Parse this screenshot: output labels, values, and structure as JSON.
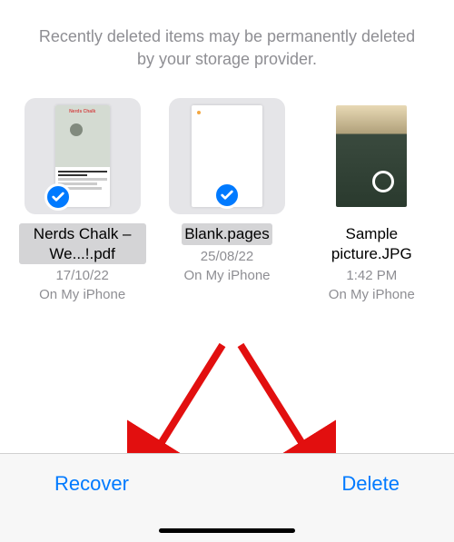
{
  "header": {
    "message": "Recently deleted items may be permanently deleted by your storage provider."
  },
  "items": [
    {
      "name": "Nerds Chalk – We...!.pdf",
      "date": "17/10/22",
      "location": "On My iPhone",
      "selected": true,
      "thumb_type": "pdf"
    },
    {
      "name": "Blank.pages",
      "date": "25/08/22",
      "location": "On My iPhone",
      "selected": true,
      "thumb_type": "blank"
    },
    {
      "name": "Sample picture.JPG",
      "date": "1:42 PM",
      "location": "On My iPhone",
      "selected": false,
      "thumb_type": "photo"
    }
  ],
  "toolbar": {
    "recover_label": "Recover",
    "delete_label": "Delete"
  }
}
